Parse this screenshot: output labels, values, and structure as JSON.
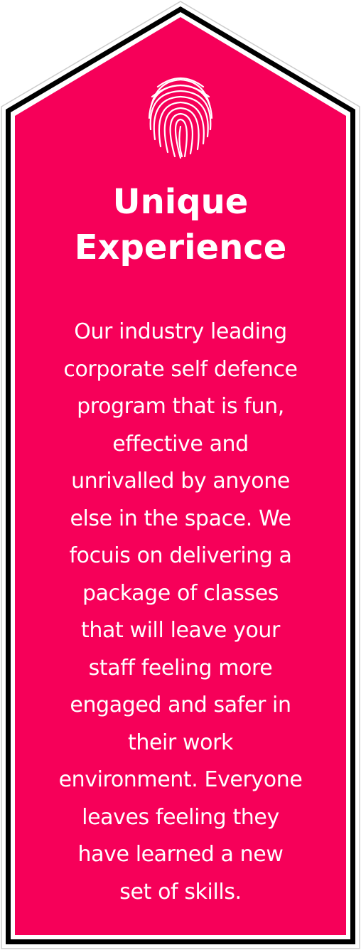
{
  "card": {
    "colors": {
      "fill": "#F60059",
      "outer_border": "#000000",
      "inner_border": "#ffffff",
      "text": "#ffffff"
    },
    "icon": "fingerprint-icon",
    "title_lines": [
      "Unique",
      "Experience"
    ],
    "body_lines": [
      "Our industry leading",
      "corporate self defence",
      "program that is fun,",
      "effective and",
      "unrivalled by anyone",
      "else in the space. We",
      "focuis on delivering a",
      "package of classes",
      "that will leave your",
      "staff feeling more",
      "engaged and safer in",
      "their work",
      "environment. Everyone",
      "leaves feeling they",
      "have learned a new",
      "set of skills."
    ]
  }
}
